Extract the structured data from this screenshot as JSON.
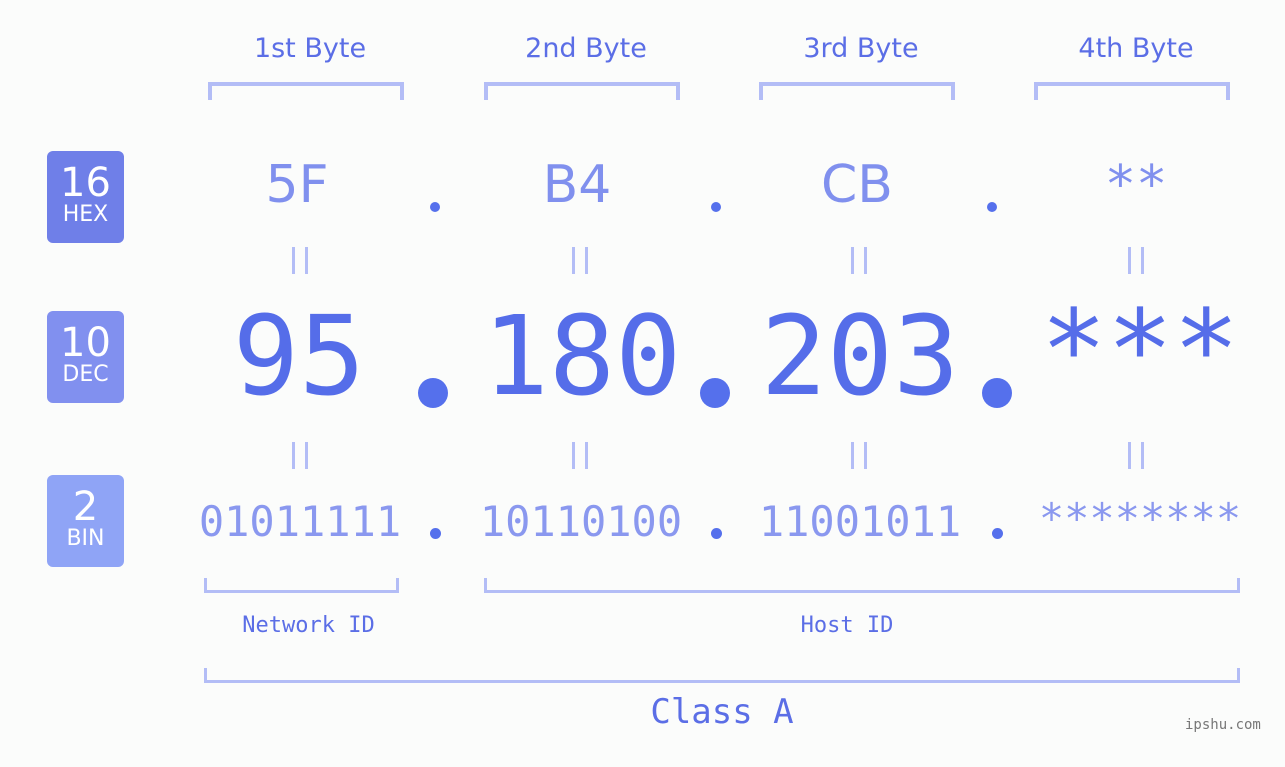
{
  "bytes": {
    "headers": [
      "1st Byte",
      "2nd Byte",
      "3rd Byte",
      "4th Byte"
    ],
    "hex": [
      "5F",
      "B4",
      "CB",
      "**"
    ],
    "dec": [
      "95",
      "180",
      "203",
      "***"
    ],
    "bin": [
      "01011111",
      "10110100",
      "11001011",
      "********"
    ],
    "equals_sign": "="
  },
  "bases": [
    {
      "number": "16",
      "label": "HEX",
      "color": "#6f7fe8"
    },
    {
      "number": "10",
      "label": "DEC",
      "color": "#8190ef"
    },
    {
      "number": "2",
      "label": "BIN",
      "color": "#8fa4f6"
    }
  ],
  "segments": {
    "network": "Network ID",
    "host": "Host ID",
    "class": "Class A"
  },
  "watermark": "ipshu.com",
  "colors": {
    "accent": "#556de9",
    "light": "#b3bdf6"
  }
}
